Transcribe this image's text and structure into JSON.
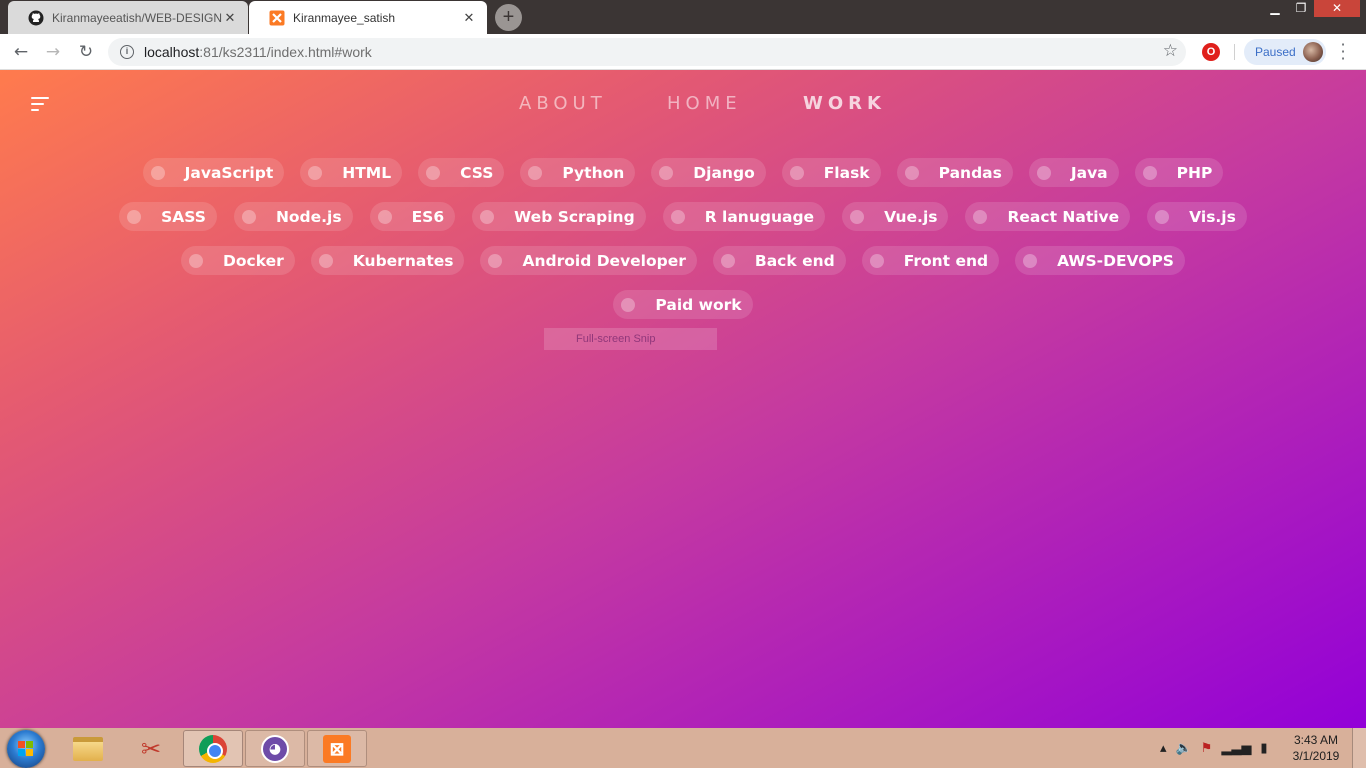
{
  "browser": {
    "tabs": [
      {
        "title": "Kiranmayeeatish/WEB-DESIGNIN",
        "icon": "github-icon",
        "active": false
      },
      {
        "title": "Kiranmayee_satish",
        "icon": "xampp-icon",
        "active": true
      }
    ],
    "new_tab": "+",
    "window_controls": {
      "minimize": "▁",
      "maximize": "❐",
      "close": "✕"
    },
    "url_host": "localhost",
    "url_path": ":81/ks2311/index.html#work",
    "profile_label": "Paused"
  },
  "page": {
    "nav": {
      "about": "ABOUT",
      "home": "HOME",
      "work": "WORK"
    },
    "tag_rows": [
      [
        "JavaScript",
        "HTML",
        "CSS",
        "Python",
        "Django",
        "Flask",
        "Pandas",
        "Java",
        "PHP"
      ],
      [
        "SASS",
        "Node.js",
        "ES6",
        "Web Scraping",
        "R lanuguage",
        "Vue.js",
        "React Native",
        "Vis.js"
      ],
      [
        "Docker",
        "Kubernates",
        "Android Developer",
        "Back end",
        "Front end",
        "AWS-DEVOPS"
      ],
      [
        "Paid work"
      ]
    ],
    "overlay_label": "Full-screen Snip"
  },
  "taskbar": {
    "time": "3:43 AM",
    "date": "3/1/2019"
  },
  "colors": {
    "gradient_start": "#ff7b4d",
    "gradient_mid": "#c53aa0",
    "gradient_end": "#9300d8",
    "taskbar": "#d8b09a"
  }
}
